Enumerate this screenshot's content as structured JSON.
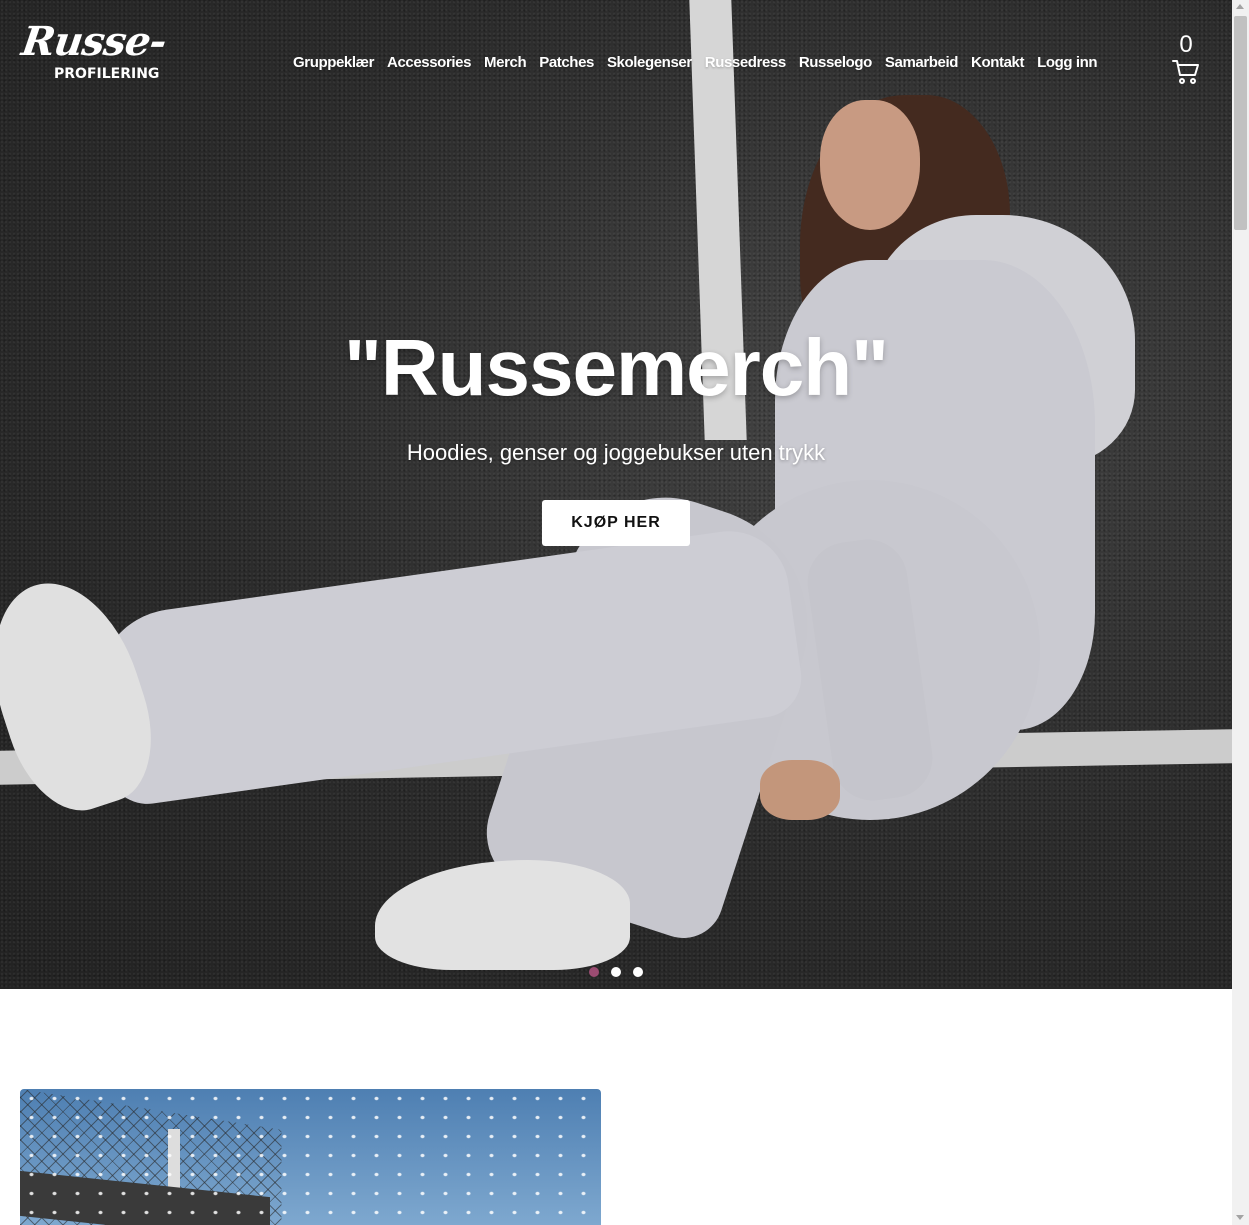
{
  "header": {
    "logo": {
      "script": "Russe-",
      "sub": "PROFILERING"
    },
    "nav": [
      {
        "label": "Gruppeklær"
      },
      {
        "label": "Accessories"
      },
      {
        "label": "Merch"
      },
      {
        "label": "Patches"
      },
      {
        "label": "Skolegenser"
      },
      {
        "label": "Russedress"
      },
      {
        "label": "Russelogo"
      },
      {
        "label": "Samarbeid"
      },
      {
        "label": "Kontakt"
      },
      {
        "label": "Logg inn"
      }
    ],
    "cart": {
      "count": "0",
      "icon": "shopping-cart-icon"
    }
  },
  "hero": {
    "title": "\"Russemerch\"",
    "subtitle": "Hoodies, genser og joggebukser uten trykk",
    "cta_label": "KJØP HER",
    "slides": {
      "count": 3,
      "active_index": 0
    }
  },
  "colors": {
    "accent_dot": "#9b4c72",
    "button_bg": "#ffffff",
    "text_light": "#ffffff"
  }
}
